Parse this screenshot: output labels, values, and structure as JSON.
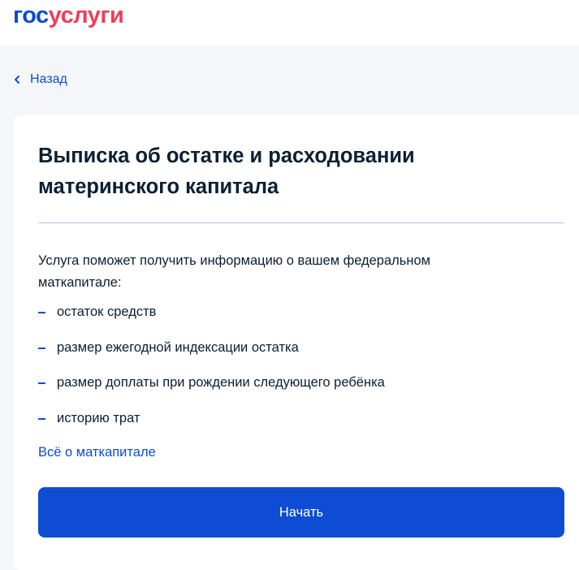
{
  "header": {
    "logo_part1": "гос",
    "logo_part2": "услуги"
  },
  "nav": {
    "back_label": "Назад"
  },
  "card": {
    "title": "Выписка об остатке и расходовании материнского капитала",
    "intro": "Услуга поможет получить информацию о вашем федеральном маткапитале:",
    "items": [
      "остаток средств",
      "размер ежегодной индексации остатка",
      "размер доплаты при рождении следующего ребёнка",
      "историю трат"
    ],
    "more_link": "Всё о маткапитале",
    "start_button": "Начать"
  },
  "colors": {
    "brand_blue": "#0d4cd3",
    "brand_red": "#ee3f58",
    "background": "#f4f6fa",
    "text": "#0b1f33",
    "divider": "#b3c3e6"
  },
  "icons": {
    "back": "chevron-left-icon",
    "bullet": "dash-icon"
  }
}
